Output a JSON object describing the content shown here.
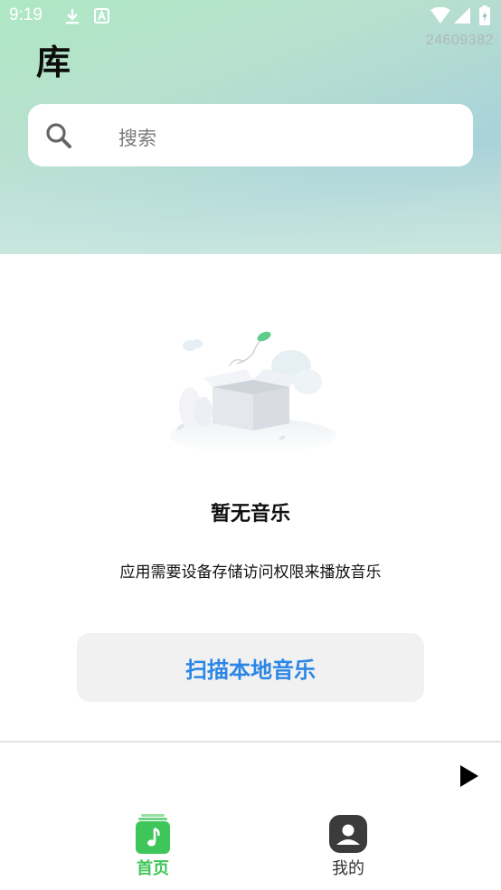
{
  "status_bar": {
    "time": "9:19",
    "icons": [
      "download-icon",
      "a-notification-icon",
      "wifi-icon",
      "signal-icon",
      "battery-icon"
    ]
  },
  "build_number": "24609382",
  "page_title": "库",
  "search": {
    "placeholder": "搜索",
    "icon": "search-icon"
  },
  "empty_state": {
    "illustration": "empty-box-icon",
    "title": "暂无音乐",
    "description": "应用需要设备存储访问权限来播放音乐",
    "scan_button_label": "扫描本地音乐"
  },
  "player": {
    "play_icon": "play-icon"
  },
  "bottom_nav": {
    "tabs": [
      {
        "label": "首页",
        "icon": "music-note-icon",
        "active": true
      },
      {
        "label": "我的",
        "icon": "user-icon",
        "active": false
      }
    ]
  },
  "colors": {
    "accent_green": "#3fc65a",
    "button_blue": "#2b86e6",
    "header_gradient_start": "#aee8c3",
    "header_gradient_end": "#a9d3d9"
  }
}
